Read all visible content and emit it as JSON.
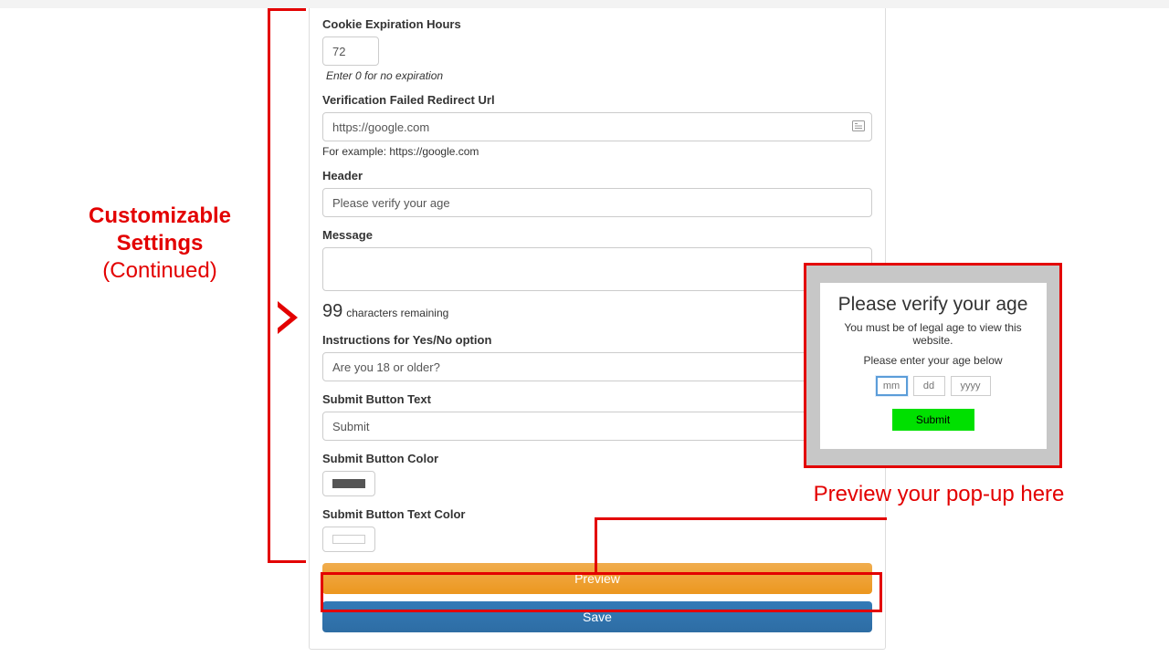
{
  "annotations": {
    "left_heading_bold": "Customizable Settings",
    "left_heading_sub": "(Continued)",
    "preview_callout": "Preview your pop-up here"
  },
  "form": {
    "cookie": {
      "label": "Cookie Expiration Hours",
      "value": "72",
      "hint": "Enter 0 for no expiration"
    },
    "redirect": {
      "label": "Verification Failed Redirect Url",
      "value": "https://google.com",
      "hint": "For example: https://google.com"
    },
    "header": {
      "label": "Header",
      "value": "Please verify your age"
    },
    "message": {
      "label": "Message",
      "value": "",
      "remaining_count": "99",
      "remaining_suffix": "characters remaining"
    },
    "instructions": {
      "label": "Instructions for Yes/No option",
      "value": "Are you 18 or older?"
    },
    "submit_text": {
      "label": "Submit Button Text",
      "value": "Submit"
    },
    "submit_color": {
      "label": "Submit Button Color",
      "value": "#555555"
    },
    "submit_text_color": {
      "label": "Submit Button Text Color",
      "value": "#ffffff"
    },
    "buttons": {
      "preview": "Preview",
      "save": "Save"
    }
  },
  "popup": {
    "title": "Please verify your age",
    "message": "You must be of legal age to view this website.",
    "instruction": "Please enter your age below",
    "mm_placeholder": "mm",
    "dd_placeholder": "dd",
    "yyyy_placeholder": "yyyy",
    "submit_label": "Submit"
  }
}
